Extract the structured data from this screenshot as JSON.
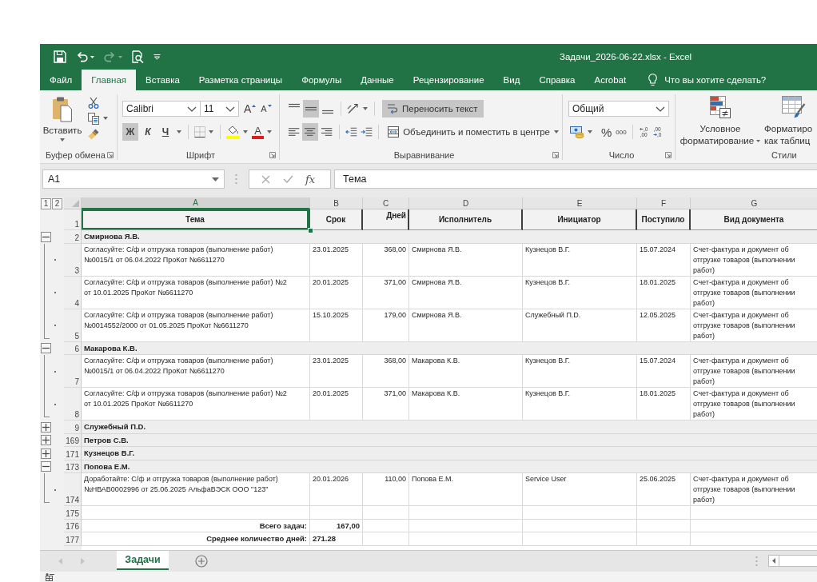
{
  "window": {
    "title": "Задачи_2026-06-22.xlsx - Excel"
  },
  "quick_access": [
    {
      "kind": "save",
      "disabled": false
    },
    {
      "kind": "undo",
      "disabled": false
    },
    {
      "kind": "redo",
      "disabled": true
    },
    {
      "kind": "preview",
      "disabled": false
    },
    {
      "kind": "customize",
      "disabled": false
    }
  ],
  "ribbon_tabs": [
    {
      "label": "Файл",
      "selected": false
    },
    {
      "label": "Главная",
      "selected": true
    },
    {
      "label": "Вставка",
      "selected": false
    },
    {
      "label": "Разметка страницы",
      "selected": false
    },
    {
      "label": "Формулы",
      "selected": false
    },
    {
      "label": "Данные",
      "selected": false
    },
    {
      "label": "Рецензирование",
      "selected": false
    },
    {
      "label": "Вид",
      "selected": false
    },
    {
      "label": "Справка",
      "selected": false
    },
    {
      "label": "Acrobat",
      "selected": false
    }
  ],
  "tell_me": "Что вы хотите сделать?",
  "ribbon": {
    "clipboard": {
      "paste": "Вставить",
      "label": "Буфер обмена"
    },
    "font": {
      "name": "Calibri",
      "size": "11",
      "grow": "A",
      "shrink": "A",
      "styles": [
        {
          "kind": "bold",
          "label": "Ж",
          "on": true
        },
        {
          "kind": "italic",
          "label": "К",
          "on": false
        },
        {
          "kind": "underline",
          "label": "Ч",
          "on": false
        }
      ],
      "color_letter": "A",
      "label": "Шрифт"
    },
    "alignment": {
      "vertical": [
        {
          "kind": "top",
          "selected": false
        },
        {
          "kind": "middle",
          "selected": true
        },
        {
          "kind": "bottom",
          "selected": false
        }
      ],
      "horizontal": [
        {
          "kind": "left",
          "selected": false
        },
        {
          "kind": "center",
          "selected": true
        },
        {
          "kind": "right",
          "selected": false
        }
      ],
      "wrap_text": {
        "label": "Переносить текст",
        "on": true
      },
      "merge": "Объединить и поместить в центре",
      "label": "Выравнивание"
    },
    "number": {
      "format": "Общий",
      "percent": "%",
      "thousands": "000",
      "decimals": [
        {
          "kind": "increase",
          "top": ",0",
          "bottom": ",00"
        },
        {
          "kind": "decrease",
          "top": ",00",
          "bottom": ",0"
        }
      ],
      "label": "Число"
    },
    "styles": {
      "conditional_formatting": [
        "Условное",
        "форматирование"
      ],
      "format_as_table": [
        "Форматиро",
        "как таблиц"
      ],
      "label": "Стили"
    }
  },
  "formula_bar": {
    "name_box": "A1",
    "function_label": "fx",
    "content": "Тема"
  },
  "outline_levels": [
    "1",
    "2"
  ],
  "columns": [
    {
      "letter": "A",
      "heading": "Тема",
      "selected": true
    },
    {
      "letter": "B",
      "heading": "Срок",
      "selected": false
    },
    {
      "letter": "C",
      "heading": "Дней",
      "selected": false
    },
    {
      "letter": "D",
      "heading": "Исполнитель",
      "selected": false
    },
    {
      "letter": "E",
      "heading": "Инициатор",
      "selected": false
    },
    {
      "letter": "F",
      "heading": "Поступило",
      "selected": false
    },
    {
      "letter": "G",
      "heading": "Вид документа",
      "selected": false
    }
  ],
  "header_row": "1",
  "groups": [
    {
      "row": "2",
      "name": "Смирнова Я.В.",
      "expanded": true,
      "children": [
        {
          "row": "3",
          "cells": [
            "Согласуйте: С/ф и отгрузка товаров (выполнение работ)\n№0015/1 от 06.04.2022 ПроКот №6611270",
            "23.01.2025",
            "368,00",
            "Смирнова Я.В.",
            "Кузнецов В.Г.",
            "15.07.2024",
            "Счет-фактура и документ об\nотгрузке товаров (выполнении\nработ)"
          ]
        },
        {
          "row": "4",
          "cells": [
            "Согласуйте: С/ф и отгрузка товаров (выполнение работ) №2\nот 10.01.2025 ПроКот №6611270",
            "20.01.2025",
            "371,00",
            "Смирнова Я.В.",
            "Кузнецов В.Г.",
            "18.01.2025",
            "Счет-фактура и документ об\nотгрузке товаров (выполнении\nработ)"
          ]
        },
        {
          "row": "5",
          "cells": [
            "Согласуйте: С/ф и отгрузка товаров (выполнение работ)\n№0014552/2000 от 01.05.2025 ПроКот №6611270",
            "15.10.2025",
            "179,00",
            "Смирнова Я.В.",
            "Служебный П.D.",
            "12.05.2025",
            "Счет-фактура и документ об\nотгрузке товаров (выполнении\nработ)"
          ]
        }
      ]
    },
    {
      "row": "6",
      "name": "Макарова К.В.",
      "expanded": true,
      "children": [
        {
          "row": "7",
          "cells": [
            "Согласуйте: С/ф и отгрузка товаров (выполнение работ)\n№0015/1 от 06.04.2022 ПроКот №6611270",
            "23.01.2025",
            "368,00",
            "Макарова К.В.",
            "Кузнецов В.Г.",
            "15.07.2024",
            "Счет-фактура и документ об\nотгрузке товаров (выполнении\nработ)"
          ]
        },
        {
          "row": "8",
          "cells": [
            "Согласуйте: С/ф и отгрузка товаров (выполнение работ) №2\nот 10.01.2025 ПроКот №6611270",
            "20.01.2025",
            "371,00",
            "Макарова К.В.",
            "Кузнецов В.Г.",
            "18.01.2025",
            "Счет-фактура и документ об\nотгрузке товаров (выполнении\nработ)"
          ]
        }
      ]
    },
    {
      "row": "9",
      "name": "Служебный П.D.",
      "expanded": false
    },
    {
      "row": "169",
      "name": "Петров С.В.",
      "expanded": false
    },
    {
      "row": "171",
      "name": "Кузнецов В.Г.",
      "expanded": false
    },
    {
      "row": "173",
      "name": "Попова Е.М.",
      "expanded": true,
      "children": [
        {
          "row": "174",
          "cells": [
            "Доработайте: С/ф и отгрузка товаров (выполнение работ)\n№НВАВ0002996 от 25.06.2025 АльфаВЭСК ООО \"123\"",
            "20.01.2026",
            "110,00",
            "Попова Е.М.",
            "Service User",
            "25.06.2025",
            "Счет-фактура и документ об\nотгрузке товаров (выполнении\nработ)"
          ]
        }
      ]
    }
  ],
  "summary_rows": [
    {
      "row": "175"
    },
    {
      "row": "176",
      "kind": "total",
      "label": "Всего задач:",
      "value": "167,00"
    },
    {
      "row": "177",
      "kind": "average",
      "label": "Среднее количество дней:",
      "value": "271.28"
    }
  ],
  "sheet_tabs": [
    {
      "label": "Задачи",
      "selected": true
    }
  ]
}
